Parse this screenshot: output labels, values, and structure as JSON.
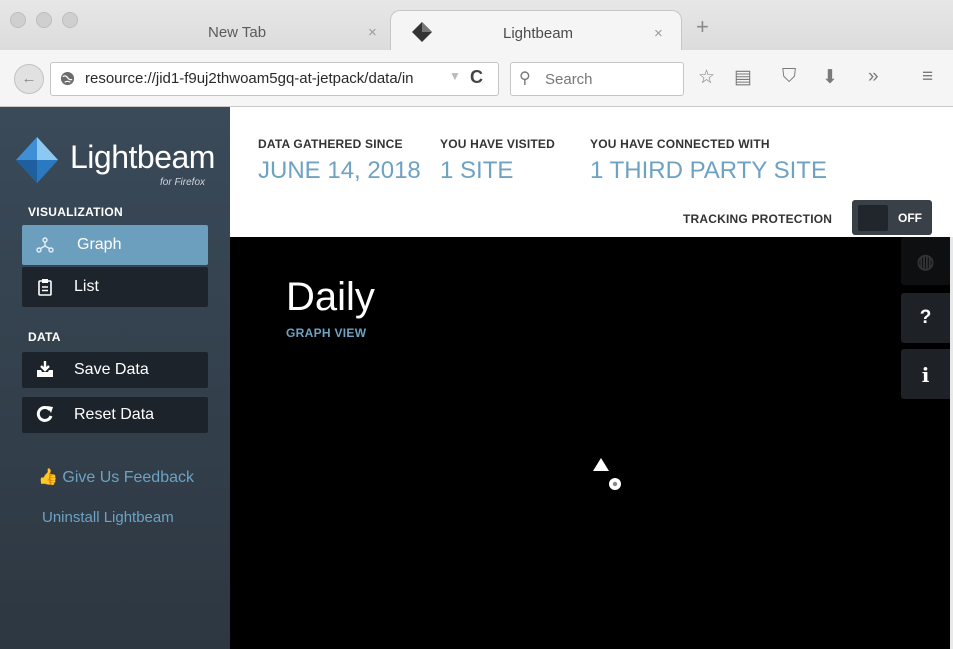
{
  "browser": {
    "tabs": [
      {
        "title": "New Tab",
        "close": "×",
        "active": false
      },
      {
        "title": "Lightbeam",
        "close": "×",
        "active": true
      }
    ],
    "new_tab": "+",
    "url": "resource://jid1-f9uj2thwoam5gq-at-jetpack/data/in",
    "search_placeholder": "Search",
    "icons": [
      "back-arrow-icon",
      "globe-icon",
      "dropdown-icon",
      "reload-icon",
      "search-icon",
      "bookmark-star-icon",
      "reading-list-icon",
      "pocket-icon",
      "download-icon",
      "overflow-chevron-icon",
      "hamburger-menu-icon"
    ]
  },
  "sidebar": {
    "logo": {
      "name": "Lightbeam",
      "sub": "for Firefox"
    },
    "visualization_label": "VISUALIZATION",
    "visualization_items": [
      {
        "label": "Graph",
        "icon": "graph-icon",
        "selected": true
      },
      {
        "label": "List",
        "icon": "clipboard-list-icon",
        "selected": false
      }
    ],
    "data_label": "DATA",
    "data_items": [
      {
        "label": "Save Data",
        "icon": "download-tray-icon"
      },
      {
        "label": "Reset Data",
        "icon": "refresh-icon"
      }
    ],
    "feedback": "Give Us Feedback",
    "uninstall": "Uninstall Lightbeam"
  },
  "header": {
    "stats": [
      {
        "label": "DATA GATHERED SINCE",
        "value": "JUNE 14, 2018"
      },
      {
        "label": "YOU HAVE VISITED",
        "value": "1 SITE"
      },
      {
        "label": "YOU HAVE CONNECTED WITH",
        "value": "1 THIRD PARTY SITE"
      }
    ],
    "tracking_protection_label": "TRACKING PROTECTION",
    "tracking_protection_state": "OFF"
  },
  "canvas": {
    "title": "Daily",
    "subtitle": "GRAPH VIEW",
    "side_buttons": [
      {
        "icon": "globe-icon",
        "glyph": "◍"
      },
      {
        "icon": "help-icon",
        "glyph": "?"
      },
      {
        "icon": "info-icon",
        "glyph": "i"
      }
    ]
  },
  "colors": {
    "accent": "#6ea2c3",
    "sidebar_bg": "#33404d",
    "selected_bg": "#6c9fbd",
    "canvas_bg": "#000000"
  }
}
